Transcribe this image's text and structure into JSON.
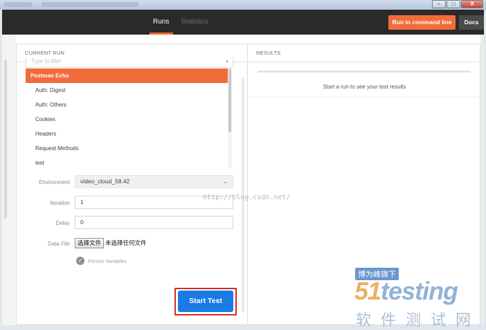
{
  "window": {
    "controls": {
      "minimize": "–",
      "maximize": "□",
      "close": "X"
    }
  },
  "header": {
    "tabs": [
      {
        "label": "Runs",
        "active": true
      },
      {
        "label": "Statistics",
        "active": false
      }
    ],
    "run_in_command_line_label": "Run in command line",
    "docs_label": "Docs"
  },
  "current_run": {
    "title": "CURRENT RUN",
    "filter_placeholder": "Type to filter",
    "collections": [
      "Postman Echo",
      "Auth: Digest",
      "Auth: Others",
      "Cookies",
      "Headers",
      "Request Methods",
      "test"
    ],
    "selected_index": 0,
    "environment": {
      "label": "Environment",
      "value": "video_cloud_58.42"
    },
    "iteration": {
      "label": "Iteration",
      "value": "1"
    },
    "delay": {
      "label": "Delay",
      "value": "0"
    },
    "data_file": {
      "label": "Data File",
      "button": "选择文件",
      "status": "未选择任何文件"
    },
    "persist_variables": {
      "label": "Persist Variables",
      "checked": true
    },
    "start_button": "Start Test"
  },
  "results": {
    "title": "RESULTS",
    "message": "Start a run to see your test results"
  },
  "watermark": {
    "url": "http://blog.csdn.net/",
    "tag": "博为峰旗下",
    "logo_num": "51",
    "logo_text": "testing",
    "sub": "软件测试网"
  },
  "colors": {
    "accent": "#f26b3a",
    "primary": "#1a7be6",
    "highlight": "#d8291c",
    "header_bg": "#2a2a2a"
  }
}
